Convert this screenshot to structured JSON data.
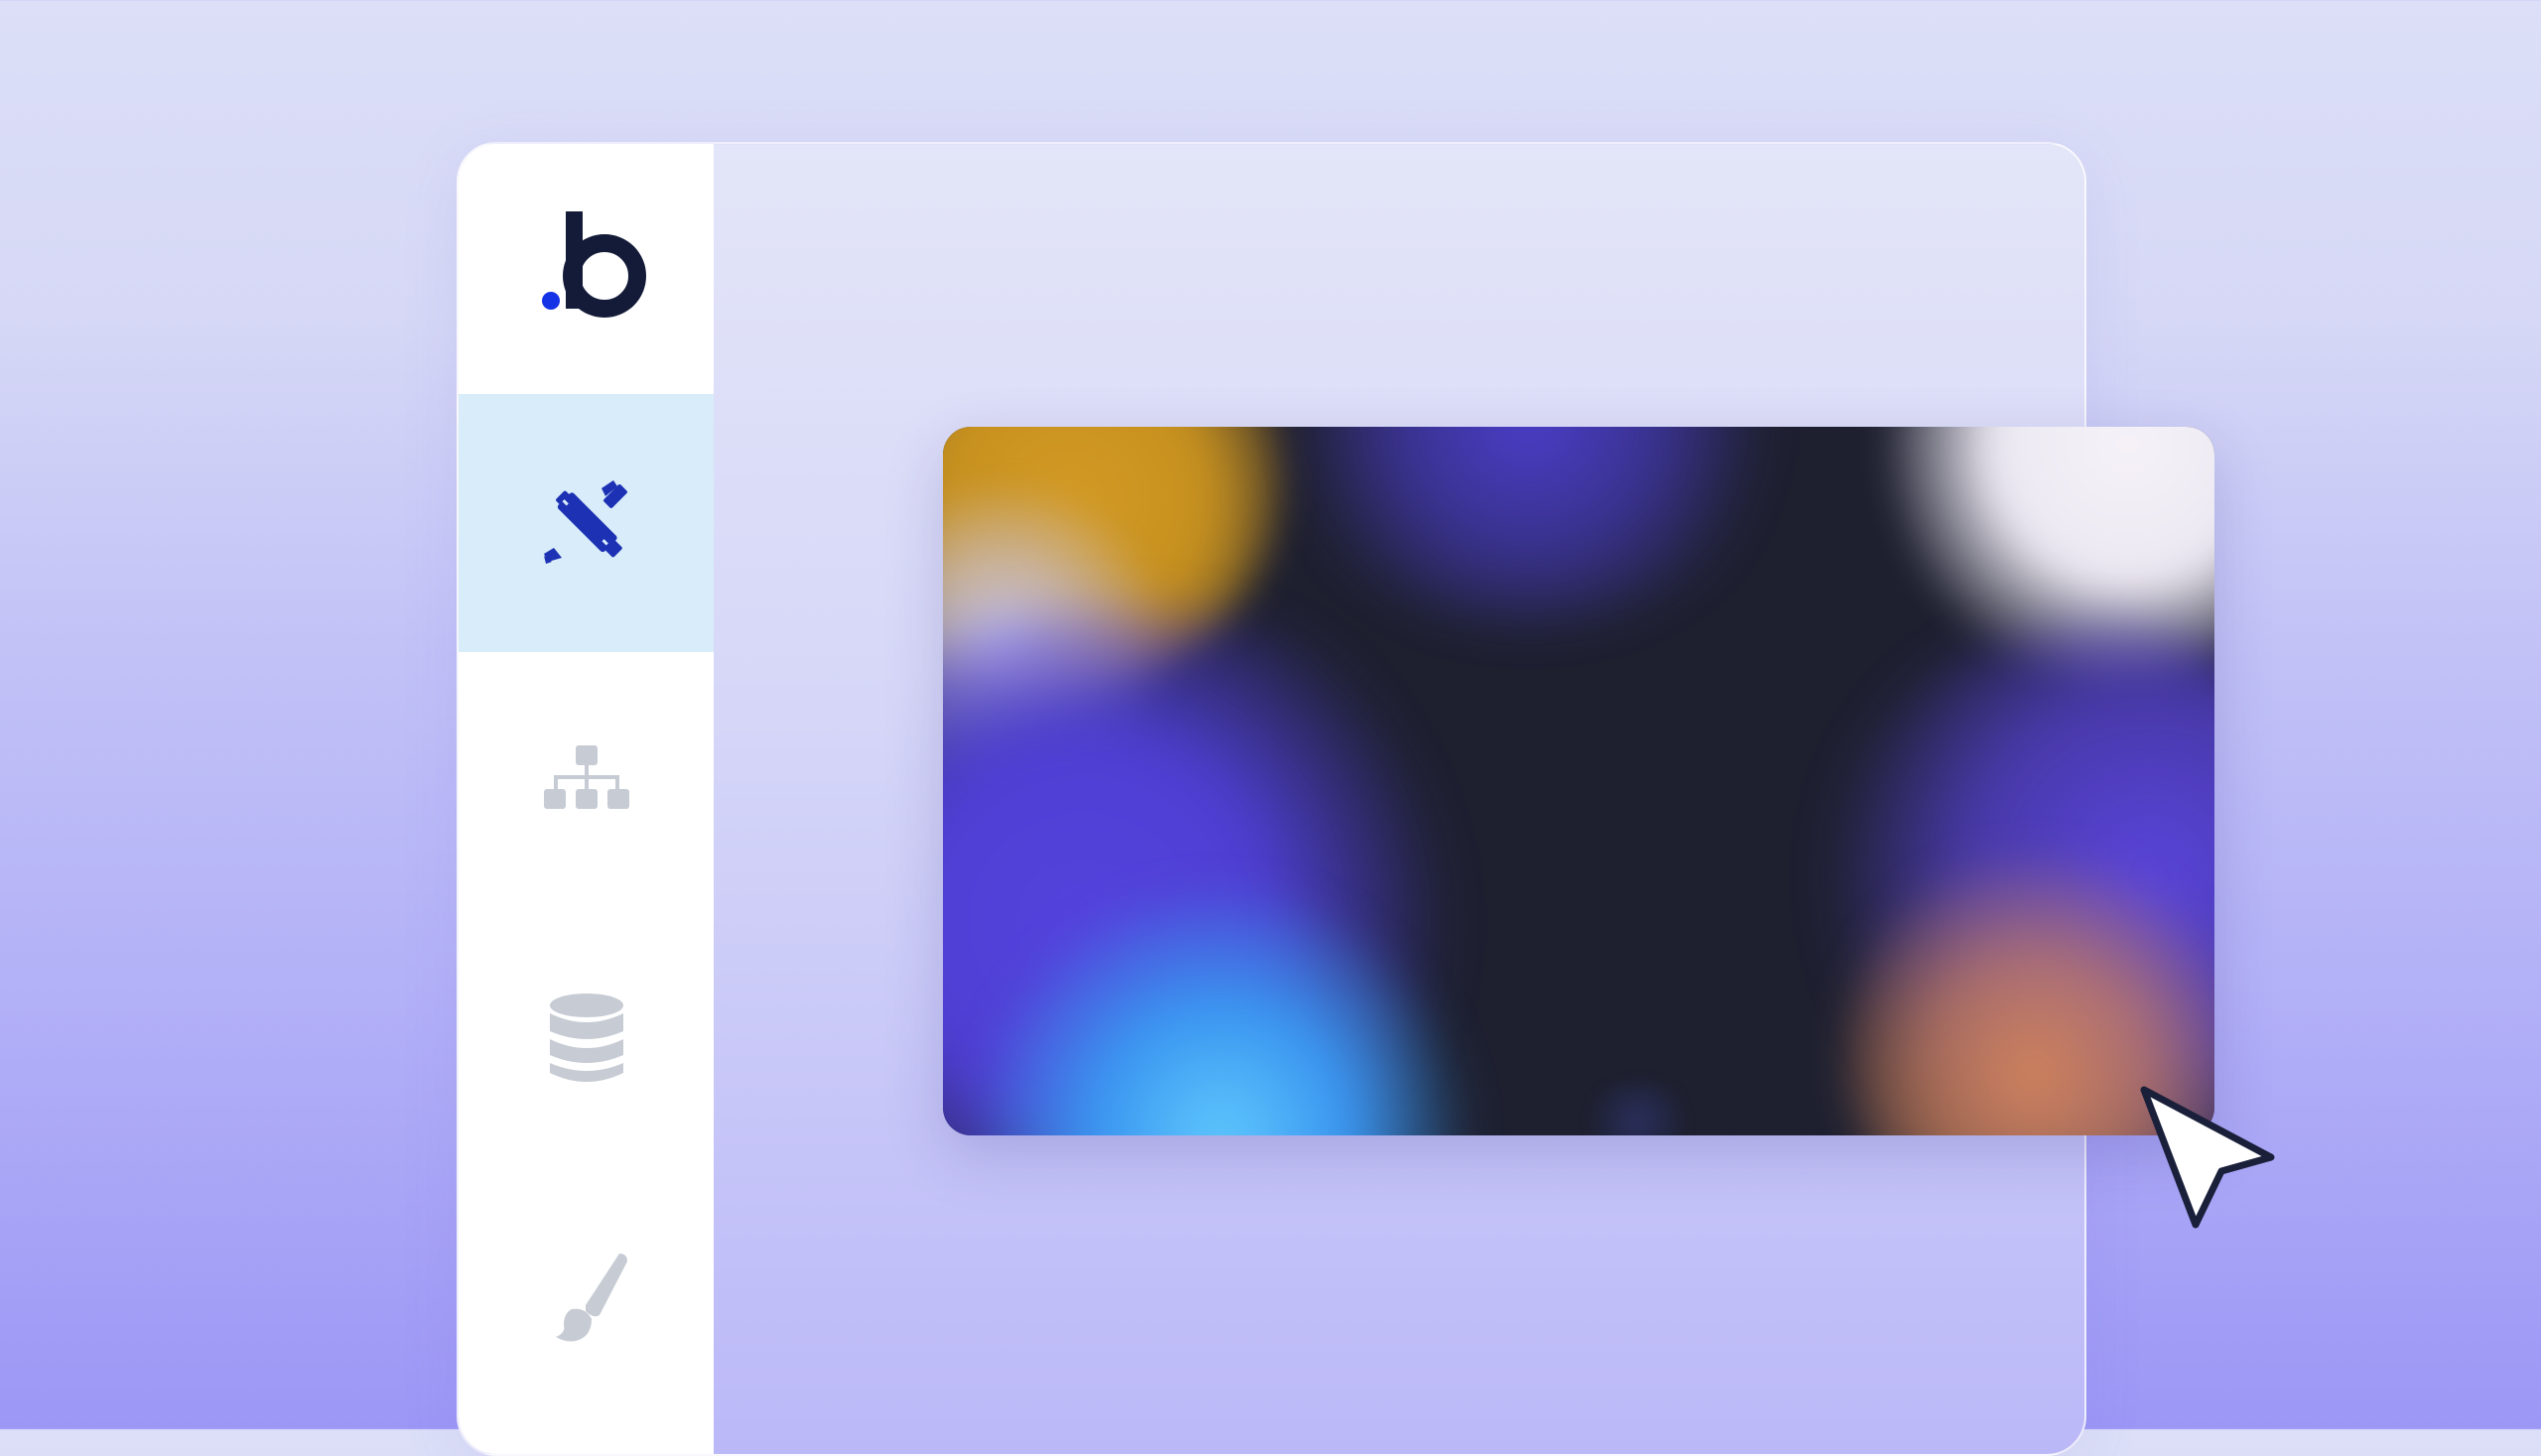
{
  "app": {
    "logo": {
      "icon": "bubble-logo",
      "glyph": "b",
      "dot_color": "#1533e6",
      "ink_color": "#141b38"
    }
  },
  "sidebar": {
    "items": [
      {
        "icon": "design-pencil-ruler-icon",
        "active": true,
        "color": "#1c31b4"
      },
      {
        "icon": "workflow-sitemap-icon",
        "active": false,
        "color": "#c7ccd4"
      },
      {
        "icon": "database-icon",
        "active": false,
        "color": "#c7ccd4"
      },
      {
        "icon": "paintbrush-styles-icon",
        "active": false,
        "color": "#c7ccd4"
      }
    ],
    "active_background": "#d8ecf9"
  },
  "canvas": {
    "media": {
      "icon": "abstract-gradient-image",
      "colors": [
        "#d39a23",
        "#5443dd",
        "#5fc8fd",
        "#f6f2f8",
        "#d1835c",
        "#1e2030"
      ]
    }
  },
  "pointer": {
    "icon": "mouse-cursor-icon"
  }
}
